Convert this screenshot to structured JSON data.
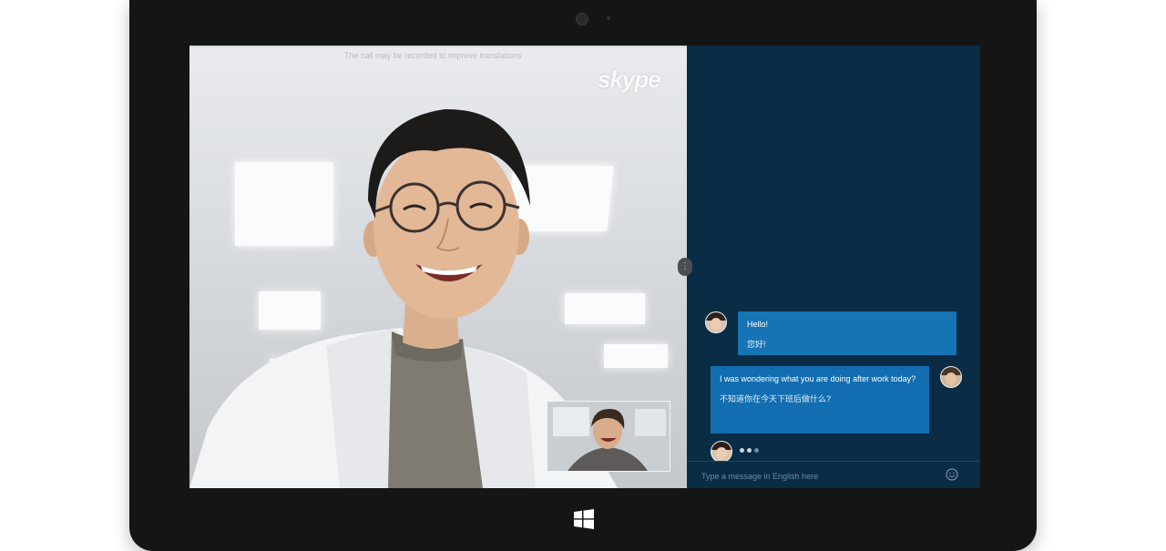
{
  "video": {
    "hint_text": "The call may be recorded to improve translations",
    "brand": "skype"
  },
  "chat": {
    "messages": [
      {
        "sender": "remote",
        "original": "Hello!",
        "translation": "您好!"
      },
      {
        "sender": "self",
        "original": "I was wondering what you are doing after work today?",
        "translation": "不知道你在今天下班后做什么?"
      }
    ],
    "composer": {
      "placeholder": "Type a message in English here"
    }
  },
  "icons": {
    "divider": "more-vertical-icon",
    "emoji": "smiley-icon",
    "windows": "windows-logo-icon"
  },
  "colors": {
    "chat_panel": "#0a2c45",
    "bubble": "#1774b4",
    "bezel": "#151515"
  }
}
